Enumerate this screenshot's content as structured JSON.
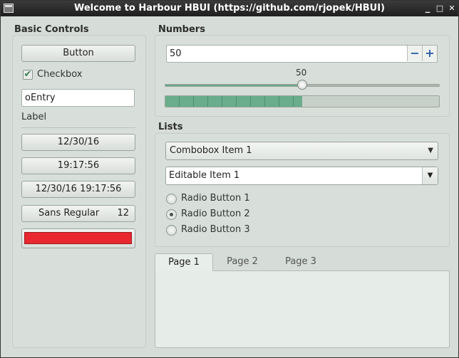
{
  "window": {
    "title": "Welcome to Harbour HBUI (https://github.com/rjopek/HBUI)",
    "controls": {
      "minimize": "_",
      "maximize": "□",
      "close": "✕"
    },
    "icon": "app-window-icon"
  },
  "basic": {
    "title": "Basic Controls",
    "button_label": "Button",
    "checkbox_label": "Checkbox",
    "checkbox_checked": true,
    "entry_value": "oEntry",
    "label_text": "Label",
    "date_button": "12/30/16",
    "time_button": "19:17:56",
    "datetime_button": "12/30/16 19:17:56",
    "font_name": "Sans Regular",
    "font_size": "12",
    "color_value": "#e8272f"
  },
  "numbers": {
    "title": "Numbers",
    "spin_value": "50",
    "minus_label": "−",
    "plus_label": "+",
    "slider_value": "50",
    "slider_fraction": 0.5,
    "progress_fraction": 0.5
  },
  "lists": {
    "title": "Lists",
    "combobox_selected": "Combobox Item 1",
    "editable_value": "Editable Item 1",
    "arrow_glyph": "▼",
    "radios": [
      {
        "label": "Radio Button 1",
        "checked": false
      },
      {
        "label": "Radio Button 2",
        "checked": true
      },
      {
        "label": "Radio Button 3",
        "checked": false
      }
    ]
  },
  "tabs": [
    {
      "label": "Page 1",
      "active": true
    },
    {
      "label": "Page 2",
      "active": false
    },
    {
      "label": "Page 3",
      "active": false
    }
  ],
  "colors": {
    "accent": "#69ad8c",
    "swatch": "#e8272f"
  }
}
